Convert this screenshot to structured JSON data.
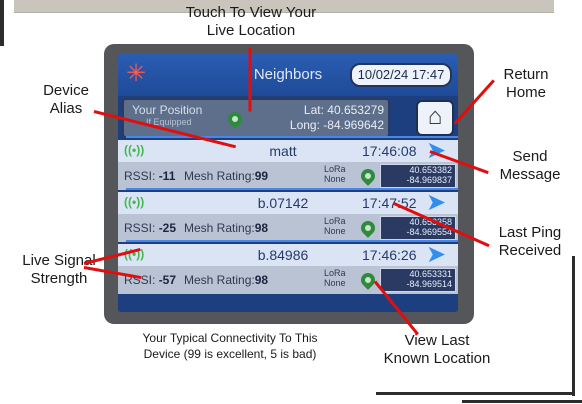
{
  "callouts": {
    "touch_location": "Touch To View Your\nLive Location",
    "device_alias": "Device\nAlias",
    "return_home": "Return\nHome",
    "send_message": "Send\nMessage",
    "last_ping": "Last Ping\nReceived",
    "live_signal": "Live Signal\nStrength",
    "view_last": "View Last\nKnown Location",
    "connectivity": "Your Typical Connectivity To This\nDevice (99 is excellent, 5 is bad)"
  },
  "screen": {
    "title": "Neighbors",
    "datetime": "10/02/24 17:47",
    "position_label": "Your Position",
    "position_sub": "If Equipped",
    "lat": "Lat:  40.653279",
    "long": "Long:  -84.969642"
  },
  "neighbors": [
    {
      "alias": "matt",
      "ping": "17:46:08",
      "rssi": "-11",
      "rating": "99",
      "lora": "LoRa",
      "lora2": "None",
      "lat": "40.653382",
      "lon": "-84.969837"
    },
    {
      "alias": "b.07142",
      "ping": "17:47:52",
      "rssi": "-25",
      "rating": "98",
      "lora": "LoRa",
      "lora2": "None",
      "lat": "40.653358",
      "lon": "-84.969554"
    },
    {
      "alias": "b.84986",
      "ping": "17:46:26",
      "rssi": "-57",
      "rating": "98",
      "lora": "LoRa",
      "lora2": "None",
      "lat": "40.653331",
      "lon": "-84.969514"
    }
  ],
  "labels": {
    "rssi": "RSSI:",
    "rating": "Mesh Rating:"
  },
  "icons": {
    "logo": "mesh-logo-icon",
    "home": "home-icon",
    "send": "send-arrow-icon",
    "signal": "signal-icon",
    "pin": "map-pin-icon"
  },
  "colors": {
    "callout_line": "#e10e0e",
    "screen_bg": "#1e3f7f",
    "send": "#2f8ff0",
    "signal": "#3fb950"
  }
}
